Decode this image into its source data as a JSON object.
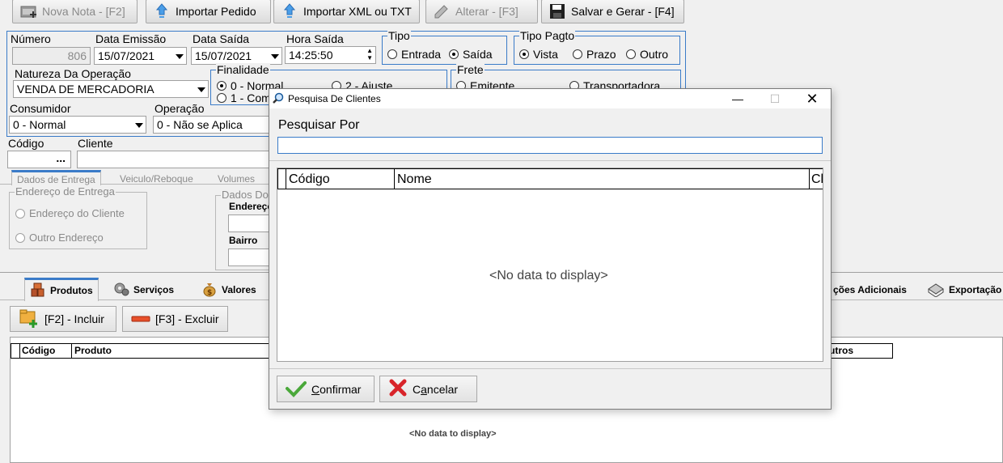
{
  "toolbar": {
    "nova_nota": "Nova Nota - [F2]",
    "importar_pedido": "Importar Pedido",
    "importar_xml": "Importar XML ou TXT",
    "alterar": "Alterar - [F3]",
    "salvar": "Salvar e Gerar - [F4]"
  },
  "form": {
    "numero_label": "Número",
    "numero_value": "806",
    "data_emissao_label": "Data Emissão",
    "data_emissao_value": "15/07/2021",
    "data_saida_label": "Data Saída",
    "data_saida_value": "15/07/2021",
    "hora_saida_label": "Hora Saída",
    "hora_saida_value": "14:25:50",
    "tipo": {
      "title": "Tipo",
      "entrada": "Entrada",
      "saida": "Saída",
      "selected": "Saída"
    },
    "tipo_pagto": {
      "title": "Tipo Pagto",
      "vista": "Vista",
      "prazo": "Prazo",
      "outro": "Outro",
      "selected": "Vista"
    },
    "natureza_label": "Natureza Da Operação",
    "natureza_value": "VENDA DE MERCADORIA",
    "finalidade": {
      "title": "Finalidade",
      "opt0": "0 - Normal",
      "opt1": "1 - Com",
      "opt2": "2 - Ajuste"
    },
    "frete": {
      "title": "Frete",
      "emitente": "Emitente",
      "transportadora": "Transportadora"
    },
    "consumidor_label": "Consumidor",
    "consumidor_value": "0 - Normal",
    "operacao_label": "Operação",
    "operacao_value": "0 - Não se Aplica",
    "codigo_label": "Código",
    "codigo_btn": "...",
    "cliente_label": "Cliente"
  },
  "tabs_top": [
    "Dados de Entrega",
    "Veiculo/Reboque",
    "Volumes"
  ],
  "entrega": {
    "endereco_title": "Endereço de Entrega",
    "endereco_cliente": "Endereço do Cliente",
    "outro_endereco": "Outro Endereço",
    "dados_title": "Dados Do",
    "endereco_label": "Endereço",
    "bairro_label": "Bairro"
  },
  "tabs_bottom": {
    "produtos": "Produtos",
    "servicos": "Serviços",
    "valores": "Valores",
    "info_adicionais": "ções Adicionais",
    "exportacao": "Exportação"
  },
  "produtos": {
    "incluir": "[F2] - Incluir",
    "excluir": "[F3] - Excluir",
    "col_codigo": "Código",
    "col_produto": "Produto",
    "col_outros": "utros",
    "no_data": "<No data to display>"
  },
  "dialog": {
    "title": "Pesquisa De Clientes",
    "pesquisar_por": "Pesquisar Por",
    "search_value": "",
    "col_codigo": "Código",
    "col_nome": "Nome",
    "col_extra": "Cl",
    "no_data": "<No data to display>",
    "confirmar_u": "C",
    "confirmar_rest": "onfirmar",
    "cancelar_pre": "C",
    "cancelar_u": "a",
    "cancelar_rest": "ncelar"
  },
  "colors": {
    "accent_border": "#3a7bc8",
    "dialog_input_border": "#3a7bc8"
  }
}
